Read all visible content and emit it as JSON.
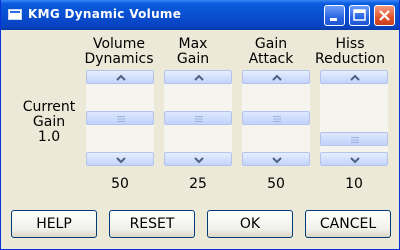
{
  "window": {
    "title": "KMG Dynamic Volume"
  },
  "current_gain": {
    "label_line1": "Current",
    "label_line2": "Gain",
    "value": "1.0"
  },
  "controls": [
    {
      "label": "Volume\nDynamics",
      "value": "50",
      "level": 0.5
    },
    {
      "label": "Max\nGain",
      "value": "25",
      "level": 0.5
    },
    {
      "label": "Gain\nAttack",
      "value": "50",
      "level": 0.5
    },
    {
      "label": "Hiss\nReduction",
      "value": "10",
      "level": 0.9
    }
  ],
  "buttons": {
    "help": "HELP",
    "reset": "RESET",
    "ok": "OK",
    "cancel": "CANCEL"
  },
  "icons": {
    "app": "window-icon",
    "minimize": "minimize-icon",
    "maximize": "maximize-icon",
    "close": "close-icon"
  },
  "colors": {
    "titlebar": "#0a4fd1",
    "window_bg": "#ece9d8",
    "scroll_button": "#c3d3fb"
  }
}
